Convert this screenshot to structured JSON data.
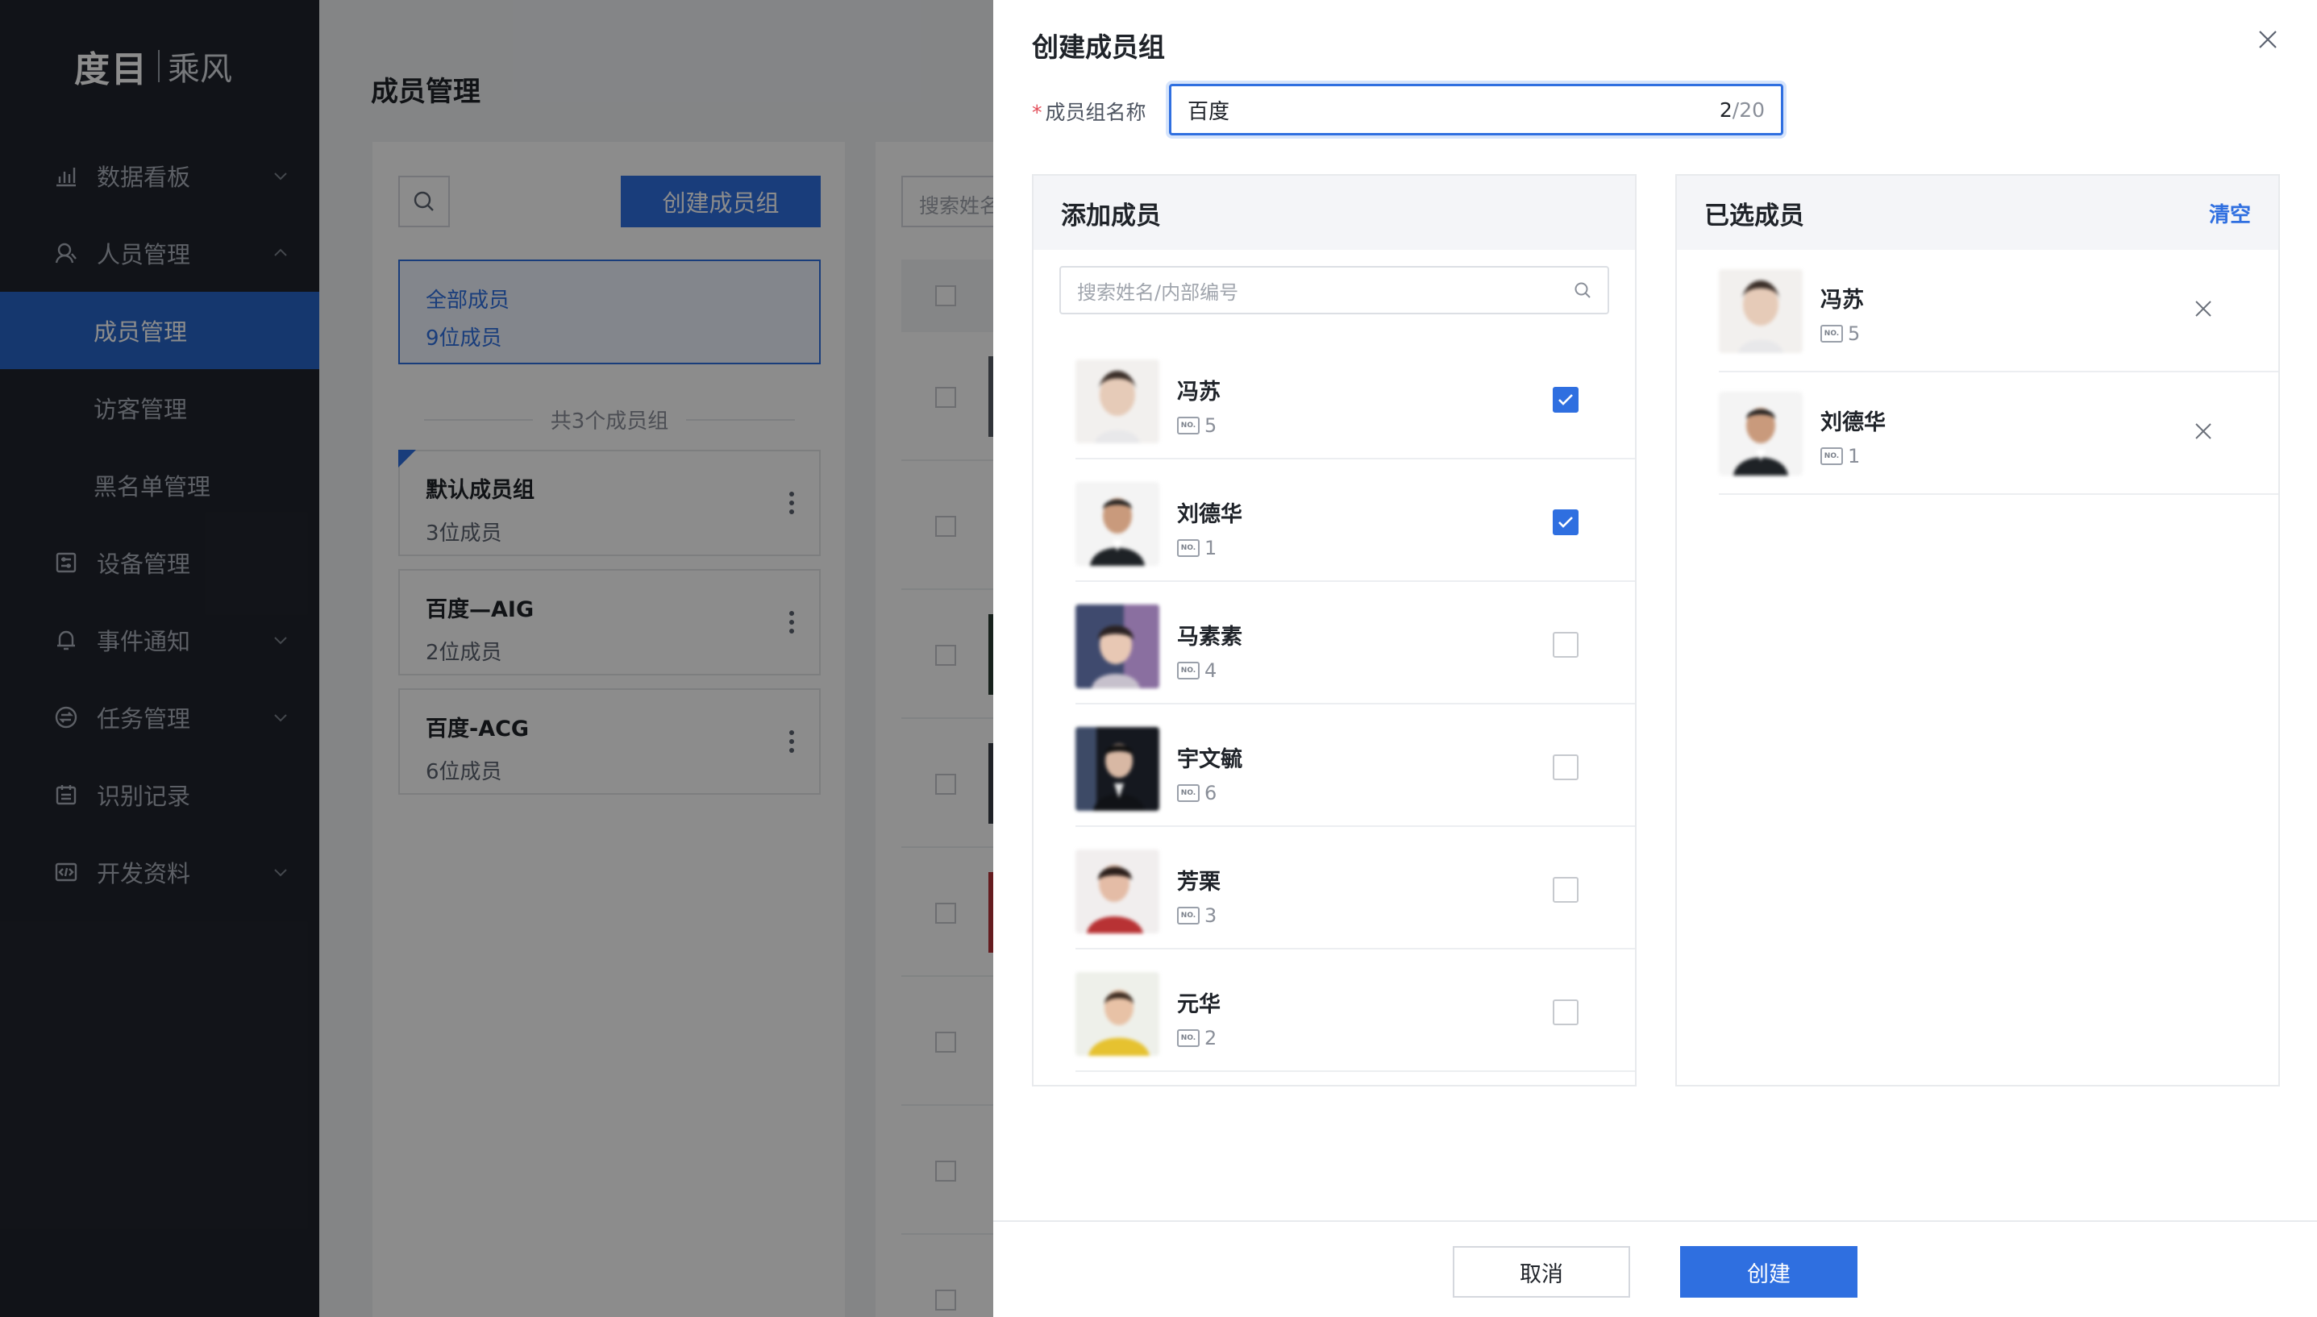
{
  "sidebar": {
    "logo_brand": "度目",
    "logo_product": "乘风",
    "items": [
      {
        "label": "数据看板",
        "icon": "bar-chart-icon"
      },
      {
        "label": "人员管理",
        "icon": "person-icon"
      },
      {
        "label": "成员管理"
      },
      {
        "label": "访客管理"
      },
      {
        "label": "黑名单管理"
      },
      {
        "label": "设备管理",
        "icon": "device-icon"
      },
      {
        "label": "事件通知",
        "icon": "bell-icon"
      },
      {
        "label": "任务管理",
        "icon": "task-icon"
      },
      {
        "label": "识别记录",
        "icon": "calendar-icon"
      },
      {
        "label": "开发资料",
        "icon": "code-icon"
      }
    ],
    "active": "成员管理"
  },
  "page": {
    "title": "成员管理",
    "create_group_label": "创建成员组",
    "all_group": {
      "name": "全部成员",
      "count": "9位成员"
    },
    "group_total": "共3个成员组",
    "groups": [
      {
        "name": "默认成员组",
        "count": "3位成员"
      },
      {
        "name": "百度—AIG",
        "count": "2位成员"
      },
      {
        "name": "百度-ACG",
        "count": "6位成员"
      }
    ],
    "table_search_placeholder": "搜索姓名"
  },
  "drawer": {
    "title": "创建成员组",
    "name_label": "成员组名称",
    "name_value": "百度",
    "name_count": "2",
    "name_max": "/20",
    "add_panel": {
      "title": "添加成员",
      "search_placeholder": "搜索姓名/内部编号",
      "members": [
        {
          "name": "冯苏",
          "no": "5",
          "checked": true
        },
        {
          "name": "刘德华",
          "no": "1",
          "checked": true
        },
        {
          "name": "马素素",
          "no": "4",
          "checked": false
        },
        {
          "name": "宇文毓",
          "no": "6",
          "checked": false
        },
        {
          "name": "芳栗",
          "no": "3",
          "checked": false
        },
        {
          "name": "元华",
          "no": "2",
          "checked": false
        }
      ]
    },
    "selected_panel": {
      "title": "已选成员",
      "clear_label": "清空",
      "members": [
        {
          "name": "冯苏",
          "no": "5"
        },
        {
          "name": "刘德华",
          "no": "1"
        }
      ]
    },
    "no_badge": "NO.",
    "cancel_label": "取消",
    "create_label": "创建"
  },
  "colors": {
    "accent": "#2f6fe0",
    "sidebar_bg": "#20242d",
    "active_nav": "#2764c8"
  }
}
